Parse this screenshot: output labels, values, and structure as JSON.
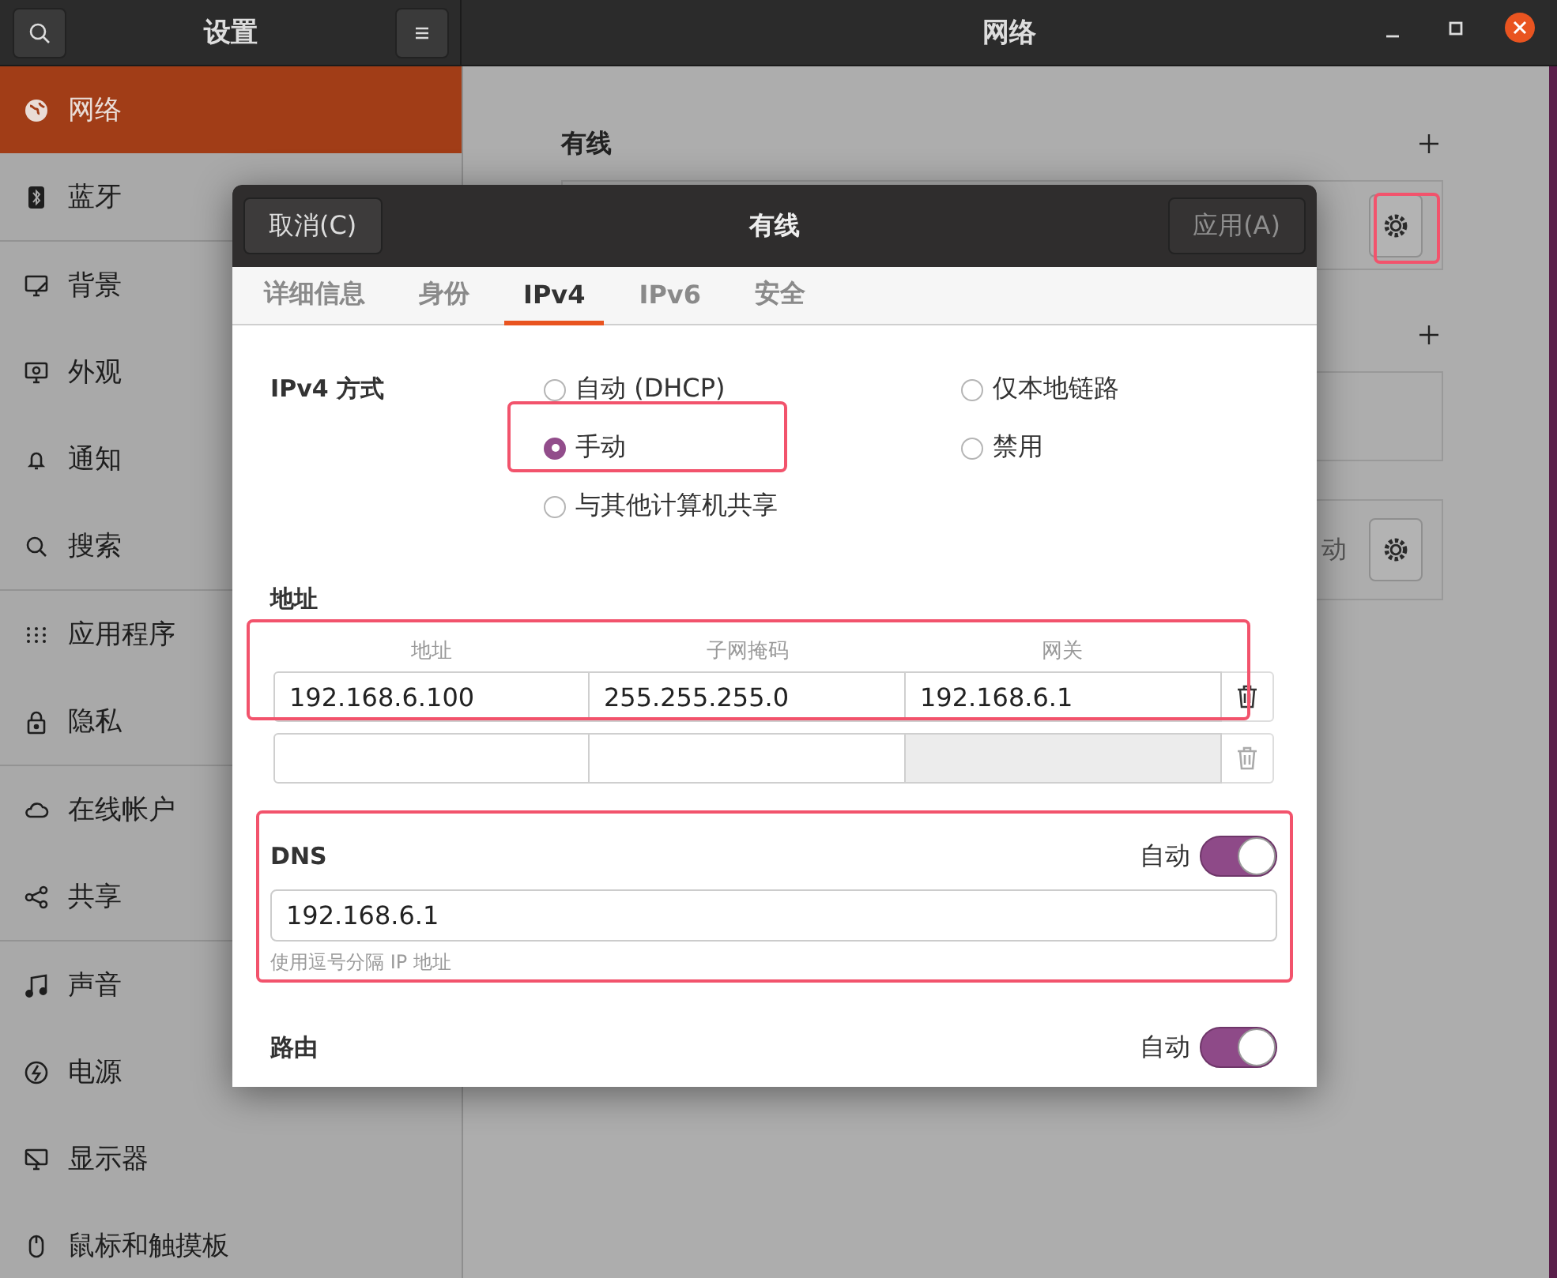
{
  "header": {
    "title": "设置",
    "page_title": "网络"
  },
  "sidebar": {
    "groups": [
      [
        {
          "label": "网络",
          "kind": "globe",
          "selected": true
        },
        {
          "label": "蓝牙",
          "kind": "bluetooth",
          "selected": false
        }
      ],
      [
        {
          "label": "背景",
          "kind": "background",
          "selected": false
        },
        {
          "label": "外观",
          "kind": "appearance",
          "selected": false
        },
        {
          "label": "通知",
          "kind": "bell",
          "selected": false
        },
        {
          "label": "搜索",
          "kind": "search",
          "selected": false
        }
      ],
      [
        {
          "label": "应用程序",
          "kind": "apps",
          "selected": false
        },
        {
          "label": "隐私",
          "kind": "lock",
          "selected": false
        }
      ],
      [
        {
          "label": "在线帐户",
          "kind": "cloud",
          "selected": false
        },
        {
          "label": "共享",
          "kind": "share",
          "selected": false
        }
      ],
      [
        {
          "label": "声音",
          "kind": "music",
          "selected": false
        },
        {
          "label": "电源",
          "kind": "power",
          "selected": false
        },
        {
          "label": "显示器",
          "kind": "display",
          "selected": false
        },
        {
          "label": "鼠标和触摸板",
          "kind": "mouse",
          "selected": false
        }
      ]
    ]
  },
  "network": {
    "sections": [
      {
        "title": "有线",
        "cards": [
          {
            "kind": "gear"
          }
        ]
      },
      {
        "cards": [
          {
            "kind": "empty"
          },
          {
            "kind": "gear",
            "text": "动"
          }
        ]
      }
    ]
  },
  "dialog": {
    "title": "有线",
    "cancel": "取消(C)",
    "apply": {
      "label": "应用(A)",
      "disabled": true
    },
    "tabs": [
      {
        "label": "详细信息",
        "selected": false
      },
      {
        "label": "身份",
        "selected": false
      },
      {
        "label": "IPv4",
        "selected": true
      },
      {
        "label": "IPv6",
        "selected": false
      },
      {
        "label": "安全",
        "selected": false
      }
    ],
    "method": {
      "label": "IPv4 方式",
      "options": [
        {
          "label": "自动 (DHCP)",
          "selected": false
        },
        {
          "label": "手动",
          "selected": true
        },
        {
          "label": "与其他计算机共享",
          "selected": false
        },
        {
          "label": "仅本地链路",
          "selected": false
        },
        {
          "label": "禁用",
          "selected": false
        }
      ]
    },
    "addresses": {
      "title": "地址",
      "columns": [
        "地址",
        "子网掩码",
        "网关"
      ],
      "rows": [
        {
          "values": [
            "192.168.6.100",
            "255.255.255.0",
            "192.168.6.1"
          ],
          "disabled": false
        },
        {
          "disabled": true
        }
      ]
    },
    "dns": {
      "title": "DNS",
      "auto_label": "自动",
      "auto": true,
      "value": "192.168.6.1",
      "hint": "使用逗号分隔 IP 地址"
    },
    "routes": {
      "title": "路由",
      "auto_label": "自动",
      "auto": true
    }
  }
}
